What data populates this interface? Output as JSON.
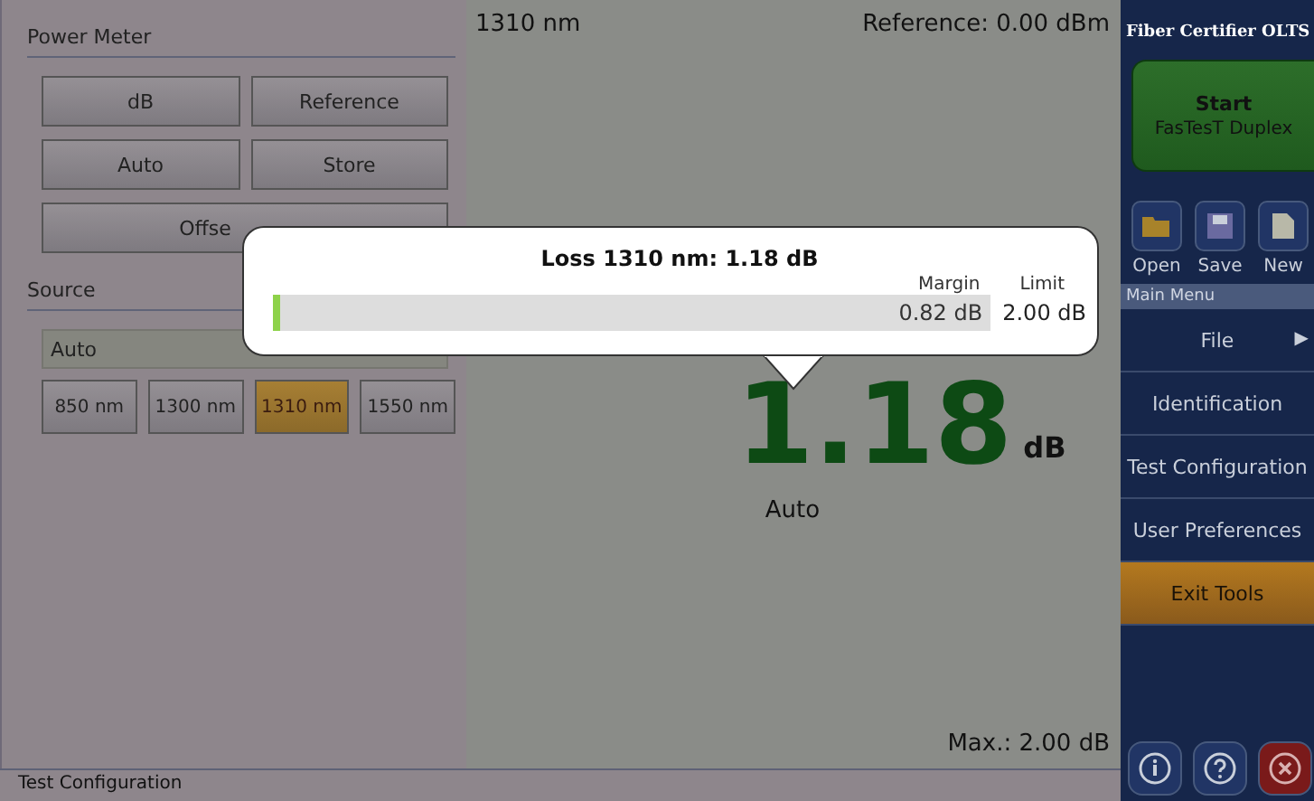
{
  "power_meter": {
    "title": "Power Meter",
    "buttons": [
      {
        "label": "dB"
      },
      {
        "label": "Reference"
      },
      {
        "label": "Auto"
      },
      {
        "label": "Store"
      },
      {
        "label": "Offse",
        "wide": true
      }
    ]
  },
  "source": {
    "title": "Source",
    "mode": "Auto",
    "wavelengths": [
      {
        "label": "850 nm",
        "selected": false
      },
      {
        "label": "1300 nm",
        "selected": false
      },
      {
        "label": "1310 nm",
        "selected": true
      },
      {
        "label": "1550 nm",
        "selected": false
      }
    ]
  },
  "measurement": {
    "wavelength": "1310 nm",
    "reference": "Reference: 0.00 dBm",
    "value": "1.18",
    "unit": "dB",
    "mode": "Auto",
    "max": "Max.: 2.00 dB"
  },
  "popup": {
    "title": "Loss 1310 nm:  1.18 dB",
    "margin_label": "Margin",
    "limit_label": "Limit",
    "level": 0.01,
    "margin": "0.82 dB",
    "limit": "2.00 dB"
  },
  "sidebar": {
    "title": "Fiber Certifier OLTS",
    "start": {
      "title": "Start",
      "subtitle": "FasTesT Duplex"
    },
    "tools": [
      {
        "kind": "open",
        "label": "Open"
      },
      {
        "kind": "save",
        "label": "Save"
      },
      {
        "kind": "new",
        "label": "New"
      }
    ],
    "menu_title": "Main Menu",
    "menu": [
      {
        "label": "File",
        "arrow": "▶",
        "highlighted": false
      },
      {
        "label": "Identification",
        "highlighted": false
      },
      {
        "label": "Test Configuration",
        "highlighted": false
      },
      {
        "label": "User Preferences",
        "highlighted": false
      },
      {
        "label": "Exit Tools",
        "highlighted": true
      }
    ],
    "bottom": [
      {
        "kind": "info"
      },
      {
        "kind": "help"
      },
      {
        "kind": "close"
      }
    ]
  },
  "status_bar": "Test Configuration"
}
